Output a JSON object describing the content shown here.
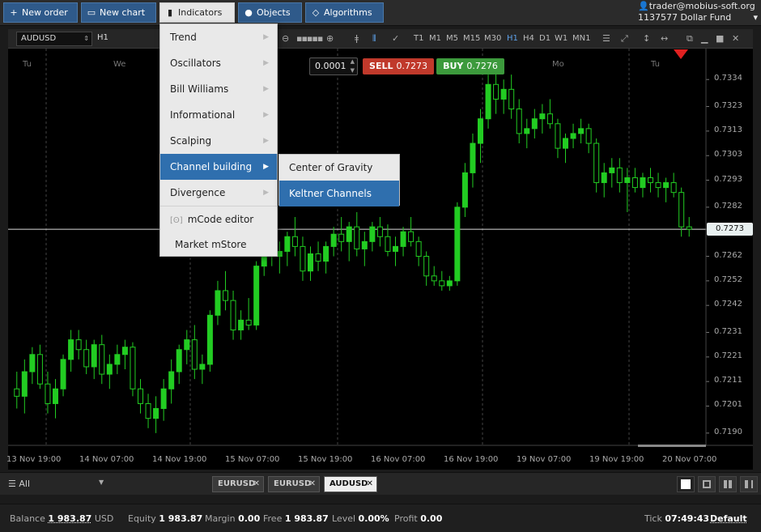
{
  "toolbar": {
    "new_order": "New order",
    "new_chart": "New chart",
    "indicators": "Indicators",
    "objects": "Objects",
    "algorithms": "Algorithms"
  },
  "user": {
    "email": "trader@mobius-soft.org",
    "account": "1137577",
    "fund": "Dollar Fund"
  },
  "chart_toolbar": {
    "symbol": "AUDUSD",
    "timeframe": "H1",
    "timeframes": [
      "T1",
      "M1",
      "M5",
      "M15",
      "M30",
      "H1",
      "H4",
      "D1",
      "W1",
      "MN1"
    ],
    "selected_timeframe": "H1"
  },
  "trade": {
    "lot": "0.0001",
    "sell_label": "SELL",
    "sell_price": "0.7273",
    "buy_label": "BUY",
    "buy_price": "0.7276"
  },
  "indicators_menu": {
    "items": [
      "Trend",
      "Oscillators",
      "Bill Williams",
      "Informational",
      "Scalping",
      "Channel building",
      "Divergence",
      "mCode editor",
      "Market mStore"
    ],
    "highlighted": "Channel building"
  },
  "submenu": {
    "items": [
      "Center of Gravity",
      "Keltner Channels"
    ],
    "highlighted": "Keltner Channels"
  },
  "chart_data": {
    "type": "candlestick",
    "symbol": "AUDUSD",
    "day_labels": [
      "Tu",
      "We",
      "Mo",
      "Tu"
    ],
    "price_ticks": [
      "0.7334",
      "0.7323",
      "0.7313",
      "0.7303",
      "0.7293",
      "0.7282",
      "0.7273",
      "0.7262",
      "0.7252",
      "0.7242",
      "0.7231",
      "0.7221",
      "0.7211",
      "0.7201",
      "0.7190"
    ],
    "current_price": "0.7273",
    "time_labels": [
      "13 Nov 19:00",
      "14 Nov 07:00",
      "14 Nov 19:00",
      "15 Nov 07:00",
      "15 Nov 19:00",
      "16 Nov 07:00",
      "16 Nov 19:00",
      "19 Nov 07:00",
      "19 Nov 19:00",
      "20 Nov 07:00"
    ],
    "ylim": [
      0.7185,
      0.734
    ],
    "candles": [
      {
        "o": 0.7208,
        "h": 0.7215,
        "l": 0.72,
        "c": 0.7205
      },
      {
        "o": 0.7205,
        "h": 0.722,
        "l": 0.7198,
        "c": 0.7215
      },
      {
        "o": 0.7215,
        "h": 0.7225,
        "l": 0.721,
        "c": 0.7222
      },
      {
        "o": 0.7222,
        "h": 0.7226,
        "l": 0.7208,
        "c": 0.721
      },
      {
        "o": 0.721,
        "h": 0.7215,
        "l": 0.7198,
        "c": 0.7202
      },
      {
        "o": 0.7202,
        "h": 0.7212,
        "l": 0.7196,
        "c": 0.7208
      },
      {
        "o": 0.7208,
        "h": 0.7222,
        "l": 0.7205,
        "c": 0.722
      },
      {
        "o": 0.722,
        "h": 0.7232,
        "l": 0.7215,
        "c": 0.7228
      },
      {
        "o": 0.7228,
        "h": 0.7232,
        "l": 0.722,
        "c": 0.7224
      },
      {
        "o": 0.7224,
        "h": 0.7228,
        "l": 0.7214,
        "c": 0.7217
      },
      {
        "o": 0.7217,
        "h": 0.7228,
        "l": 0.7212,
        "c": 0.7226
      },
      {
        "o": 0.7226,
        "h": 0.723,
        "l": 0.721,
        "c": 0.7214
      },
      {
        "o": 0.7214,
        "h": 0.7222,
        "l": 0.7208,
        "c": 0.7218
      },
      {
        "o": 0.7218,
        "h": 0.7226,
        "l": 0.7214,
        "c": 0.7222
      },
      {
        "o": 0.7222,
        "h": 0.7228,
        "l": 0.7216,
        "c": 0.7225
      },
      {
        "o": 0.7225,
        "h": 0.7227,
        "l": 0.7205,
        "c": 0.7208
      },
      {
        "o": 0.7208,
        "h": 0.7212,
        "l": 0.7198,
        "c": 0.7202
      },
      {
        "o": 0.7202,
        "h": 0.7206,
        "l": 0.7192,
        "c": 0.7196
      },
      {
        "o": 0.7196,
        "h": 0.7205,
        "l": 0.719,
        "c": 0.72
      },
      {
        "o": 0.72,
        "h": 0.7212,
        "l": 0.7195,
        "c": 0.7208
      },
      {
        "o": 0.7208,
        "h": 0.722,
        "l": 0.7202,
        "c": 0.7215
      },
      {
        "o": 0.7215,
        "h": 0.7226,
        "l": 0.721,
        "c": 0.7224
      },
      {
        "o": 0.7224,
        "h": 0.7232,
        "l": 0.7218,
        "c": 0.7228
      },
      {
        "o": 0.7228,
        "h": 0.7234,
        "l": 0.7212,
        "c": 0.7216
      },
      {
        "o": 0.7216,
        "h": 0.7222,
        "l": 0.721,
        "c": 0.7218
      },
      {
        "o": 0.7218,
        "h": 0.724,
        "l": 0.7215,
        "c": 0.7238
      },
      {
        "o": 0.7238,
        "h": 0.7252,
        "l": 0.7234,
        "c": 0.7248
      },
      {
        "o": 0.7248,
        "h": 0.7256,
        "l": 0.724,
        "c": 0.7244
      },
      {
        "o": 0.7244,
        "h": 0.7248,
        "l": 0.7228,
        "c": 0.7232
      },
      {
        "o": 0.7232,
        "h": 0.724,
        "l": 0.7228,
        "c": 0.7236
      },
      {
        "o": 0.7236,
        "h": 0.7245,
        "l": 0.7232,
        "c": 0.7234
      },
      {
        "o": 0.7234,
        "h": 0.726,
        "l": 0.7232,
        "c": 0.7258
      },
      {
        "o": 0.7258,
        "h": 0.7272,
        "l": 0.7254,
        "c": 0.7268
      },
      {
        "o": 0.7268,
        "h": 0.7275,
        "l": 0.7258,
        "c": 0.7262
      },
      {
        "o": 0.7262,
        "h": 0.7268,
        "l": 0.7255,
        "c": 0.7264
      },
      {
        "o": 0.7264,
        "h": 0.7272,
        "l": 0.7258,
        "c": 0.727
      },
      {
        "o": 0.727,
        "h": 0.7278,
        "l": 0.7262,
        "c": 0.7266
      },
      {
        "o": 0.7266,
        "h": 0.727,
        "l": 0.7252,
        "c": 0.7256
      },
      {
        "o": 0.7256,
        "h": 0.7266,
        "l": 0.7252,
        "c": 0.7263
      },
      {
        "o": 0.7263,
        "h": 0.7268,
        "l": 0.7256,
        "c": 0.726
      },
      {
        "o": 0.726,
        "h": 0.7268,
        "l": 0.7255,
        "c": 0.7266
      },
      {
        "o": 0.7266,
        "h": 0.7274,
        "l": 0.7262,
        "c": 0.7271
      },
      {
        "o": 0.7271,
        "h": 0.7278,
        "l": 0.7264,
        "c": 0.7268
      },
      {
        "o": 0.7268,
        "h": 0.7276,
        "l": 0.726,
        "c": 0.7274
      },
      {
        "o": 0.7274,
        "h": 0.728,
        "l": 0.7262,
        "c": 0.7265
      },
      {
        "o": 0.7265,
        "h": 0.7272,
        "l": 0.7258,
        "c": 0.7268
      },
      {
        "o": 0.7268,
        "h": 0.7276,
        "l": 0.7264,
        "c": 0.7274
      },
      {
        "o": 0.7274,
        "h": 0.7278,
        "l": 0.7266,
        "c": 0.727
      },
      {
        "o": 0.727,
        "h": 0.7275,
        "l": 0.7262,
        "c": 0.7264
      },
      {
        "o": 0.7264,
        "h": 0.727,
        "l": 0.7258,
        "c": 0.7266
      },
      {
        "o": 0.7266,
        "h": 0.7274,
        "l": 0.7262,
        "c": 0.7272
      },
      {
        "o": 0.7272,
        "h": 0.7278,
        "l": 0.7266,
        "c": 0.7268
      },
      {
        "o": 0.7268,
        "h": 0.727,
        "l": 0.7258,
        "c": 0.7262
      },
      {
        "o": 0.7262,
        "h": 0.7264,
        "l": 0.725,
        "c": 0.7254
      },
      {
        "o": 0.7254,
        "h": 0.7258,
        "l": 0.725,
        "c": 0.7252
      },
      {
        "o": 0.7252,
        "h": 0.7256,
        "l": 0.7248,
        "c": 0.725
      },
      {
        "o": 0.725,
        "h": 0.7254,
        "l": 0.7248,
        "c": 0.7252
      },
      {
        "o": 0.7252,
        "h": 0.7284,
        "l": 0.725,
        "c": 0.7282
      },
      {
        "o": 0.7282,
        "h": 0.73,
        "l": 0.7278,
        "c": 0.7296
      },
      {
        "o": 0.7296,
        "h": 0.7312,
        "l": 0.729,
        "c": 0.7308
      },
      {
        "o": 0.7308,
        "h": 0.7322,
        "l": 0.73,
        "c": 0.7318
      },
      {
        "o": 0.7318,
        "h": 0.7336,
        "l": 0.7314,
        "c": 0.7332
      },
      {
        "o": 0.7332,
        "h": 0.734,
        "l": 0.732,
        "c": 0.7326
      },
      {
        "o": 0.7326,
        "h": 0.7334,
        "l": 0.732,
        "c": 0.733
      },
      {
        "o": 0.733,
        "h": 0.7336,
        "l": 0.7318,
        "c": 0.7322
      },
      {
        "o": 0.7322,
        "h": 0.7326,
        "l": 0.7308,
        "c": 0.7312
      },
      {
        "o": 0.7312,
        "h": 0.7318,
        "l": 0.7306,
        "c": 0.7314
      },
      {
        "o": 0.7314,
        "h": 0.7322,
        "l": 0.731,
        "c": 0.7318
      },
      {
        "o": 0.7318,
        "h": 0.7324,
        "l": 0.7312,
        "c": 0.732
      },
      {
        "o": 0.732,
        "h": 0.7326,
        "l": 0.7314,
        "c": 0.7316
      },
      {
        "o": 0.7316,
        "h": 0.7318,
        "l": 0.7302,
        "c": 0.7306
      },
      {
        "o": 0.7306,
        "h": 0.7312,
        "l": 0.73,
        "c": 0.731
      },
      {
        "o": 0.731,
        "h": 0.7316,
        "l": 0.7306,
        "c": 0.7312
      },
      {
        "o": 0.7312,
        "h": 0.7318,
        "l": 0.7308,
        "c": 0.7314
      },
      {
        "o": 0.7314,
        "h": 0.7316,
        "l": 0.7304,
        "c": 0.7308
      },
      {
        "o": 0.7308,
        "h": 0.731,
        "l": 0.7288,
        "c": 0.7292
      },
      {
        "o": 0.7292,
        "h": 0.73,
        "l": 0.7286,
        "c": 0.7296
      },
      {
        "o": 0.7296,
        "h": 0.7302,
        "l": 0.729,
        "c": 0.7298
      },
      {
        "o": 0.7298,
        "h": 0.7302,
        "l": 0.7288,
        "c": 0.7292
      },
      {
        "o": 0.7292,
        "h": 0.7298,
        "l": 0.728,
        "c": 0.7294
      },
      {
        "o": 0.7294,
        "h": 0.7298,
        "l": 0.7288,
        "c": 0.729
      },
      {
        "o": 0.729,
        "h": 0.7296,
        "l": 0.7286,
        "c": 0.7294
      },
      {
        "o": 0.7294,
        "h": 0.7298,
        "l": 0.7288,
        "c": 0.7292
      },
      {
        "o": 0.7292,
        "h": 0.7296,
        "l": 0.7286,
        "c": 0.729
      },
      {
        "o": 0.729,
        "h": 0.7294,
        "l": 0.7284,
        "c": 0.7292
      },
      {
        "o": 0.7292,
        "h": 0.7296,
        "l": 0.7286,
        "c": 0.7288
      },
      {
        "o": 0.7288,
        "h": 0.729,
        "l": 0.727,
        "c": 0.7274
      },
      {
        "o": 0.7274,
        "h": 0.7278,
        "l": 0.727,
        "c": 0.7273
      }
    ]
  },
  "bottom_bar": {
    "filter": "All",
    "tabs": [
      "EURUSD",
      "EURUSD",
      "AUDUSD"
    ],
    "active_tab": "AUDUSD"
  },
  "status": {
    "balance_label": "Balance",
    "balance": "1 983.87",
    "balance_ccy": "USD",
    "equity_label": "Equity",
    "equity": "1 983.87",
    "margin_label": "Margin",
    "margin": "0.00",
    "free_label": "Free",
    "free": "1 983.87",
    "level_label": "Level",
    "level": "0.00%",
    "profit_label": "Profit",
    "profit": "0.00",
    "tick_label": "Tick",
    "tick": "07:49:43",
    "profile": "Default"
  },
  "colors": {
    "bull": "#22cc22",
    "bear": "#22cc22",
    "sell": "#c0392b",
    "buy": "#3c9a3c",
    "accent": "#2f6fae"
  }
}
